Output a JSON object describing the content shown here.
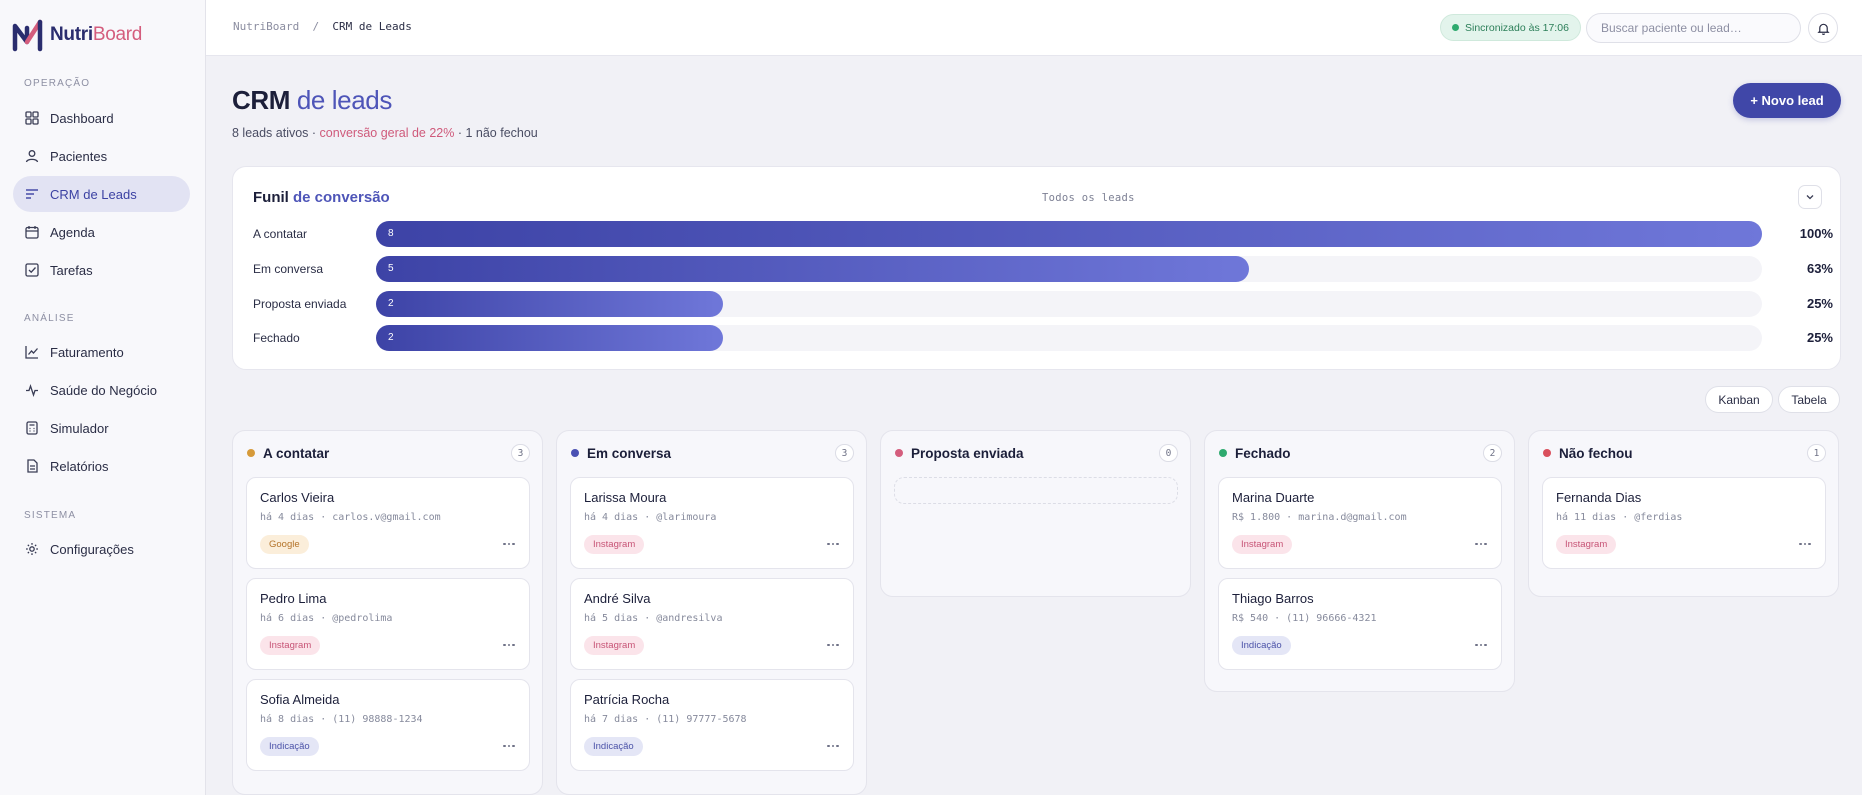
{
  "app": {
    "name_part1": "Nutri",
    "name_part2": "Board"
  },
  "sidebar": {
    "sections": [
      {
        "label": "OPERAÇÃO"
      },
      {
        "label": "ANÁLISE"
      },
      {
        "label": "SISTEMA"
      }
    ],
    "items": [
      {
        "label": "Dashboard",
        "icon": "grid-icon"
      },
      {
        "label": "Pacientes",
        "icon": "user-icon"
      },
      {
        "label": "CRM de Leads",
        "icon": "crm-icon",
        "active": true
      },
      {
        "label": "Agenda",
        "icon": "calendar-icon"
      },
      {
        "label": "Tarefas",
        "icon": "checkbox-icon"
      },
      {
        "label": "Faturamento",
        "icon": "line-chart-icon"
      },
      {
        "label": "Saúde do Negócio",
        "icon": "pulse-icon"
      },
      {
        "label": "Simulador",
        "icon": "calculator-icon"
      },
      {
        "label": "Relatórios",
        "icon": "document-icon"
      },
      {
        "label": "Configurações",
        "icon": "gear-icon"
      }
    ]
  },
  "topbar": {
    "breadcrumb_root": "NutriBoard",
    "breadcrumb_sep": "/",
    "breadcrumb_current": "CRM de Leads",
    "sync_status": "Sincronizado às 17:06",
    "search_placeholder": "Buscar paciente ou lead…"
  },
  "header": {
    "title_part1": "CRM",
    "title_part2": "de leads",
    "sub_part1": "8 leads ativos · ",
    "sub_highlight": "conversão geral de 22%",
    "sub_part2": " · 1 não fechou",
    "new_lead_label": "+ Novo lead"
  },
  "funnel": {
    "title_part1": "Funil",
    "title_part2": "de conversão",
    "filter_label": "Todos os leads",
    "stages": [
      {
        "label": "A contatar",
        "count": "8",
        "percent": "100%",
        "fill": 1.0
      },
      {
        "label": "Em conversa",
        "count": "5",
        "percent": "63%",
        "fill": 0.63
      },
      {
        "label": "Proposta enviada",
        "count": "2",
        "percent": "25%",
        "fill": 0.25
      },
      {
        "label": "Fechado",
        "count": "2",
        "percent": "25%",
        "fill": 0.25
      }
    ]
  },
  "views": {
    "kanban": "Kanban",
    "table": "Tabela"
  },
  "columns": [
    {
      "title": "A contatar",
      "count": "3",
      "dot_color": "#d69a3a",
      "cards": [
        {
          "name": "Carlos Vieira",
          "meta": "há 4 dias · carlos.v@gmail.com",
          "source": "Google",
          "source_type": "google"
        },
        {
          "name": "Pedro Lima",
          "meta": "há 6 dias · @pedrolima",
          "source": "Instagram",
          "source_type": "instagram"
        },
        {
          "name": "Sofia Almeida",
          "meta": "há 8 dias · (11) 98888-1234",
          "source": "Indicação",
          "source_type": "indicacao"
        }
      ]
    },
    {
      "title": "Em conversa",
      "count": "3",
      "dot_color": "#4a51b3",
      "cards": [
        {
          "name": "Larissa Moura",
          "meta": "há 4 dias · @larimoura",
          "source": "Instagram",
          "source_type": "instagram"
        },
        {
          "name": "André Silva",
          "meta": "há 5 dias · @andresilva",
          "source": "Instagram",
          "source_type": "instagram"
        },
        {
          "name": "Patrícia Rocha",
          "meta": "há 7 dias · (11) 97777-5678",
          "source": "Indicação",
          "source_type": "indicacao"
        }
      ]
    },
    {
      "title": "Proposta enviada",
      "count": "0",
      "dot_color": "#d45d7d",
      "cards": []
    },
    {
      "title": "Fechado",
      "count": "2",
      "dot_color": "#2faa6f",
      "cards": [
        {
          "name": "Marina Duarte",
          "meta": "R$ 1.800 · marina.d@gmail.com",
          "source": "Instagram",
          "source_type": "instagram"
        },
        {
          "name": "Thiago Barros",
          "meta": "R$ 540 · (11) 96666-4321",
          "source": "Indicação",
          "source_type": "indicacao"
        }
      ]
    },
    {
      "title": "Não fechou",
      "count": "1",
      "dot_color": "#d94f5c",
      "cards": [
        {
          "name": "Fernanda Dias",
          "meta": "há 11 dias · @ferdias",
          "source": "Instagram",
          "source_type": "instagram"
        }
      ]
    }
  ]
}
